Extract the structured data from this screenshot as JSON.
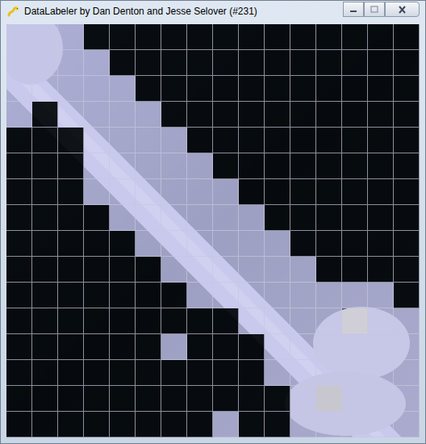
{
  "window": {
    "title": "DataLabeler by Dan Denton and Jesse Selover (#231)"
  },
  "grid": {
    "rows": [
      {
        "cells": [
          {
            "kind": "positive"
          },
          {
            "kind": "positive"
          },
          {
            "kind": "positive"
          },
          {
            "kind": "negative"
          },
          {
            "kind": "negative"
          },
          {
            "kind": "negative"
          },
          {
            "kind": "negative"
          },
          {
            "kind": "negative"
          },
          {
            "kind": "negative"
          },
          {
            "kind": "negative"
          },
          {
            "kind": "negative"
          },
          {
            "kind": "negative"
          },
          {
            "kind": "negative"
          },
          {
            "kind": "negative"
          },
          {
            "kind": "negative"
          },
          {
            "kind": "negative"
          }
        ]
      },
      {
        "cells": [
          {
            "kind": "positive"
          },
          {
            "kind": "positive"
          },
          {
            "kind": "positive"
          },
          {
            "kind": "positive"
          },
          {
            "kind": "negative"
          },
          {
            "kind": "negative"
          },
          {
            "kind": "negative"
          },
          {
            "kind": "negative"
          },
          {
            "kind": "negative"
          },
          {
            "kind": "negative"
          },
          {
            "kind": "negative"
          },
          {
            "kind": "negative"
          },
          {
            "kind": "negative"
          },
          {
            "kind": "negative"
          },
          {
            "kind": "negative"
          },
          {
            "kind": "negative"
          }
        ]
      },
      {
        "cells": [
          {
            "kind": "positive"
          },
          {
            "kind": "positive"
          },
          {
            "kind": "positive"
          },
          {
            "kind": "positive"
          },
          {
            "kind": "positive"
          },
          {
            "kind": "negative"
          },
          {
            "kind": "negative"
          },
          {
            "kind": "negative"
          },
          {
            "kind": "negative"
          },
          {
            "kind": "negative"
          },
          {
            "kind": "negative"
          },
          {
            "kind": "negative"
          },
          {
            "kind": "negative"
          },
          {
            "kind": "negative"
          },
          {
            "kind": "negative"
          },
          {
            "kind": "negative"
          }
        ]
      },
      {
        "cells": [
          {
            "kind": "positive"
          },
          {
            "kind": "negative"
          },
          {
            "kind": "positive"
          },
          {
            "kind": "positive"
          },
          {
            "kind": "positive"
          },
          {
            "kind": "positive"
          },
          {
            "kind": "negative"
          },
          {
            "kind": "negative"
          },
          {
            "kind": "negative"
          },
          {
            "kind": "negative"
          },
          {
            "kind": "negative"
          },
          {
            "kind": "negative"
          },
          {
            "kind": "negative"
          },
          {
            "kind": "negative"
          },
          {
            "kind": "negative"
          },
          {
            "kind": "negative"
          }
        ]
      },
      {
        "cells": [
          {
            "kind": "negative"
          },
          {
            "kind": "negative"
          },
          {
            "kind": "negative"
          },
          {
            "kind": "positive"
          },
          {
            "kind": "positive"
          },
          {
            "kind": "positive"
          },
          {
            "kind": "positive"
          },
          {
            "kind": "negative"
          },
          {
            "kind": "negative"
          },
          {
            "kind": "negative"
          },
          {
            "kind": "negative"
          },
          {
            "kind": "negative"
          },
          {
            "kind": "negative"
          },
          {
            "kind": "negative"
          },
          {
            "kind": "negative"
          },
          {
            "kind": "negative"
          }
        ]
      },
      {
        "cells": [
          {
            "kind": "negative"
          },
          {
            "kind": "negative"
          },
          {
            "kind": "negative"
          },
          {
            "kind": "positive"
          },
          {
            "kind": "positive"
          },
          {
            "kind": "positive"
          },
          {
            "kind": "positive"
          },
          {
            "kind": "positive"
          },
          {
            "kind": "negative"
          },
          {
            "kind": "negative"
          },
          {
            "kind": "negative"
          },
          {
            "kind": "negative"
          },
          {
            "kind": "negative"
          },
          {
            "kind": "negative"
          },
          {
            "kind": "negative"
          },
          {
            "kind": "negative"
          }
        ]
      },
      {
        "cells": [
          {
            "kind": "negative"
          },
          {
            "kind": "negative"
          },
          {
            "kind": "negative"
          },
          {
            "kind": "positive"
          },
          {
            "kind": "positive"
          },
          {
            "kind": "positive"
          },
          {
            "kind": "positive"
          },
          {
            "kind": "positive"
          },
          {
            "kind": "positive"
          },
          {
            "kind": "negative"
          },
          {
            "kind": "negative"
          },
          {
            "kind": "negative"
          },
          {
            "kind": "negative"
          },
          {
            "kind": "negative"
          },
          {
            "kind": "negative"
          },
          {
            "kind": "negative"
          }
        ]
      },
      {
        "cells": [
          {
            "kind": "negative"
          },
          {
            "kind": "negative"
          },
          {
            "kind": "negative"
          },
          {
            "kind": "negative"
          },
          {
            "kind": "positive"
          },
          {
            "kind": "positive"
          },
          {
            "kind": "positive"
          },
          {
            "kind": "positive"
          },
          {
            "kind": "positive"
          },
          {
            "kind": "positive"
          },
          {
            "kind": "negative"
          },
          {
            "kind": "negative"
          },
          {
            "kind": "negative"
          },
          {
            "kind": "negative"
          },
          {
            "kind": "negative"
          },
          {
            "kind": "negative"
          }
        ]
      },
      {
        "cells": [
          {
            "kind": "negative"
          },
          {
            "kind": "negative"
          },
          {
            "kind": "negative"
          },
          {
            "kind": "negative"
          },
          {
            "kind": "negative"
          },
          {
            "kind": "positive"
          },
          {
            "kind": "positive"
          },
          {
            "kind": "positive"
          },
          {
            "kind": "positive"
          },
          {
            "kind": "positive"
          },
          {
            "kind": "positive"
          },
          {
            "kind": "negative"
          },
          {
            "kind": "negative"
          },
          {
            "kind": "negative"
          },
          {
            "kind": "negative"
          },
          {
            "kind": "negative"
          }
        ]
      },
      {
        "cells": [
          {
            "kind": "negative"
          },
          {
            "kind": "negative"
          },
          {
            "kind": "negative"
          },
          {
            "kind": "negative"
          },
          {
            "kind": "negative"
          },
          {
            "kind": "negative"
          },
          {
            "kind": "positive"
          },
          {
            "kind": "positive"
          },
          {
            "kind": "positive"
          },
          {
            "kind": "positive"
          },
          {
            "kind": "positive"
          },
          {
            "kind": "positive"
          },
          {
            "kind": "negative"
          },
          {
            "kind": "negative"
          },
          {
            "kind": "negative"
          },
          {
            "kind": "negative"
          }
        ]
      },
      {
        "cells": [
          {
            "kind": "negative"
          },
          {
            "kind": "negative"
          },
          {
            "kind": "negative"
          },
          {
            "kind": "negative"
          },
          {
            "kind": "negative"
          },
          {
            "kind": "negative"
          },
          {
            "kind": "negative"
          },
          {
            "kind": "positive"
          },
          {
            "kind": "positive"
          },
          {
            "kind": "positive"
          },
          {
            "kind": "positive"
          },
          {
            "kind": "positive"
          },
          {
            "kind": "positive"
          },
          {
            "kind": "positive"
          },
          {
            "kind": "positive"
          },
          {
            "kind": "negative"
          }
        ]
      },
      {
        "cells": [
          {
            "kind": "negative"
          },
          {
            "kind": "negative"
          },
          {
            "kind": "negative"
          },
          {
            "kind": "negative"
          },
          {
            "kind": "negative"
          },
          {
            "kind": "negative"
          },
          {
            "kind": "negative"
          },
          {
            "kind": "negative"
          },
          {
            "kind": "negative"
          },
          {
            "kind": "positive"
          },
          {
            "kind": "positive"
          },
          {
            "kind": "positive"
          },
          {
            "kind": "positive"
          },
          {
            "kind": "unlabeled"
          },
          {
            "kind": "positive"
          },
          {
            "kind": "positive"
          }
        ]
      },
      {
        "cells": [
          {
            "kind": "negative"
          },
          {
            "kind": "negative"
          },
          {
            "kind": "negative"
          },
          {
            "kind": "negative"
          },
          {
            "kind": "negative"
          },
          {
            "kind": "negative"
          },
          {
            "kind": "positive"
          },
          {
            "kind": "negative"
          },
          {
            "kind": "negative"
          },
          {
            "kind": "negative"
          },
          {
            "kind": "positive"
          },
          {
            "kind": "positive"
          },
          {
            "kind": "positive"
          },
          {
            "kind": "positive"
          },
          {
            "kind": "positive"
          },
          {
            "kind": "positive"
          }
        ]
      },
      {
        "cells": [
          {
            "kind": "negative"
          },
          {
            "kind": "negative"
          },
          {
            "kind": "negative"
          },
          {
            "kind": "negative"
          },
          {
            "kind": "negative"
          },
          {
            "kind": "negative"
          },
          {
            "kind": "negative"
          },
          {
            "kind": "negative"
          },
          {
            "kind": "negative"
          },
          {
            "kind": "negative"
          },
          {
            "kind": "positive"
          },
          {
            "kind": "positive"
          },
          {
            "kind": "positive"
          },
          {
            "kind": "positive"
          },
          {
            "kind": "positive"
          },
          {
            "kind": "positive"
          }
        ]
      },
      {
        "cells": [
          {
            "kind": "negative"
          },
          {
            "kind": "negative"
          },
          {
            "kind": "negative"
          },
          {
            "kind": "negative"
          },
          {
            "kind": "negative"
          },
          {
            "kind": "negative"
          },
          {
            "kind": "negative"
          },
          {
            "kind": "negative"
          },
          {
            "kind": "negative"
          },
          {
            "kind": "negative"
          },
          {
            "kind": "negative"
          },
          {
            "kind": "positive"
          },
          {
            "kind": "unlabeled"
          },
          {
            "kind": "positive"
          },
          {
            "kind": "positive"
          },
          {
            "kind": "positive"
          }
        ]
      },
      {
        "cells": [
          {
            "kind": "negative"
          },
          {
            "kind": "negative"
          },
          {
            "kind": "negative"
          },
          {
            "kind": "negative"
          },
          {
            "kind": "negative"
          },
          {
            "kind": "negative"
          },
          {
            "kind": "negative"
          },
          {
            "kind": "negative"
          },
          {
            "kind": "positive"
          },
          {
            "kind": "negative"
          },
          {
            "kind": "negative"
          },
          {
            "kind": "positive"
          },
          {
            "kind": "positive"
          },
          {
            "kind": "positive"
          },
          {
            "kind": "positive"
          },
          {
            "kind": "positive"
          }
        ]
      }
    ]
  }
}
